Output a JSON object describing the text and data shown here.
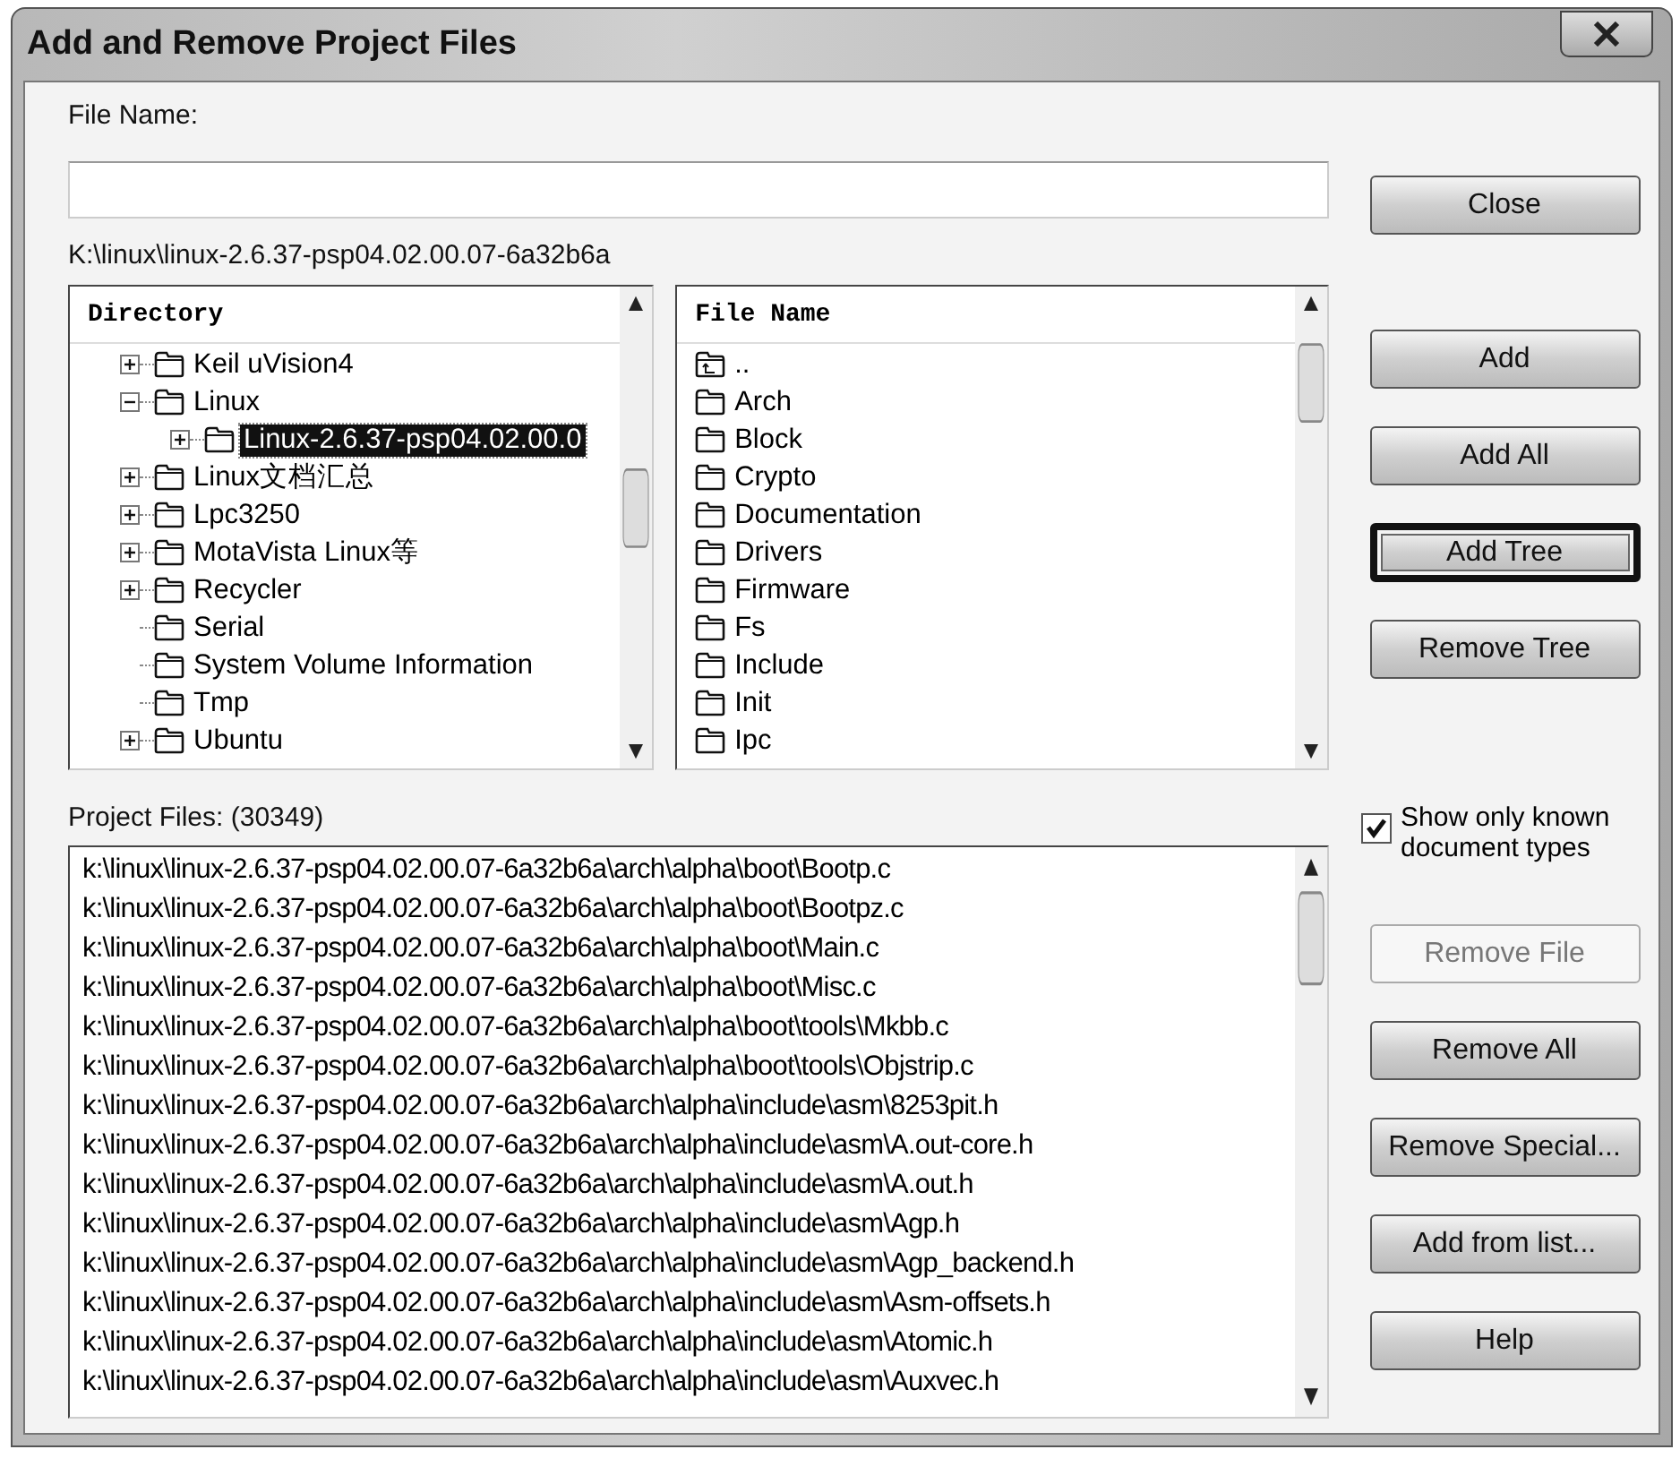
{
  "window": {
    "title": "Add and Remove Project Files"
  },
  "file_name": {
    "label": "File Name:"
  },
  "current_path": "K:\\linux\\linux-2.6.37-psp04.02.00.07-6a32b6a",
  "directory": {
    "header": "Directory",
    "items": [
      {
        "label": "Keil uVision4",
        "kind": "branch",
        "expanded": false,
        "selected": false
      },
      {
        "label": "Linux",
        "kind": "branch",
        "expanded": true,
        "selected": false,
        "children": [
          {
            "label": "Linux-2.6.37-psp04.02.00.0",
            "kind": "branch",
            "expanded": false,
            "selected": true
          }
        ]
      },
      {
        "label": "Linux文档汇总",
        "kind": "branch",
        "expanded": false,
        "selected": false
      },
      {
        "label": "Lpc3250",
        "kind": "branch",
        "expanded": false,
        "selected": false
      },
      {
        "label": "MotaVista Linux等",
        "kind": "branch",
        "expanded": false,
        "selected": false
      },
      {
        "label": "Recycler",
        "kind": "branch",
        "expanded": false,
        "selected": false
      },
      {
        "label": "Serial",
        "kind": "leaf",
        "selected": false
      },
      {
        "label": "System Volume Information",
        "kind": "leaf",
        "selected": false
      },
      {
        "label": "Tmp",
        "kind": "leaf",
        "selected": false
      },
      {
        "label": "Ubuntu",
        "kind": "branch",
        "expanded": false,
        "selected": false
      }
    ]
  },
  "files": {
    "header": "File Name",
    "items": [
      {
        "label": "..",
        "kind": "parent"
      },
      {
        "label": "Arch",
        "kind": "folder"
      },
      {
        "label": "Block",
        "kind": "folder"
      },
      {
        "label": "Crypto",
        "kind": "folder"
      },
      {
        "label": "Documentation",
        "kind": "folder"
      },
      {
        "label": "Drivers",
        "kind": "folder"
      },
      {
        "label": "Firmware",
        "kind": "folder"
      },
      {
        "label": "Fs",
        "kind": "folder"
      },
      {
        "label": "Include",
        "kind": "folder"
      },
      {
        "label": "Init",
        "kind": "folder"
      },
      {
        "label": "Ipc",
        "kind": "folder"
      }
    ]
  },
  "project_files": {
    "label": "Project Files: (30349)",
    "rows": [
      "k:\\linux\\linux-2.6.37-psp04.02.00.07-6a32b6a\\arch\\alpha\\boot\\Bootp.c",
      "k:\\linux\\linux-2.6.37-psp04.02.00.07-6a32b6a\\arch\\alpha\\boot\\Bootpz.c",
      "k:\\linux\\linux-2.6.37-psp04.02.00.07-6a32b6a\\arch\\alpha\\boot\\Main.c",
      "k:\\linux\\linux-2.6.37-psp04.02.00.07-6a32b6a\\arch\\alpha\\boot\\Misc.c",
      "k:\\linux\\linux-2.6.37-psp04.02.00.07-6a32b6a\\arch\\alpha\\boot\\tools\\Mkbb.c",
      "k:\\linux\\linux-2.6.37-psp04.02.00.07-6a32b6a\\arch\\alpha\\boot\\tools\\Objstrip.c",
      "k:\\linux\\linux-2.6.37-psp04.02.00.07-6a32b6a\\arch\\alpha\\include\\asm\\8253pit.h",
      "k:\\linux\\linux-2.6.37-psp04.02.00.07-6a32b6a\\arch\\alpha\\include\\asm\\A.out-core.h",
      "k:\\linux\\linux-2.6.37-psp04.02.00.07-6a32b6a\\arch\\alpha\\include\\asm\\A.out.h",
      "k:\\linux\\linux-2.6.37-psp04.02.00.07-6a32b6a\\arch\\alpha\\include\\asm\\Agp.h",
      "k:\\linux\\linux-2.6.37-psp04.02.00.07-6a32b6a\\arch\\alpha\\include\\asm\\Agp_backend.h",
      "k:\\linux\\linux-2.6.37-psp04.02.00.07-6a32b6a\\arch\\alpha\\include\\asm\\Asm-offsets.h",
      "k:\\linux\\linux-2.6.37-psp04.02.00.07-6a32b6a\\arch\\alpha\\include\\asm\\Atomic.h",
      "k:\\linux\\linux-2.6.37-psp04.02.00.07-6a32b6a\\arch\\alpha\\include\\asm\\Auxvec.h"
    ]
  },
  "buttons": [
    {
      "kind": "button",
      "label": "Close",
      "disabled": false,
      "focused": false
    },
    {
      "kind": "button",
      "label": "Add",
      "disabled": false,
      "focused": false
    },
    {
      "kind": "button",
      "label": "Add All",
      "disabled": false,
      "focused": false
    },
    {
      "kind": "button",
      "label": "Add Tree",
      "disabled": false,
      "focused": true
    },
    {
      "kind": "button",
      "label": "Remove Tree",
      "disabled": false,
      "focused": false
    },
    {
      "kind": "checkbox",
      "label": "Show only known document types",
      "checked": true
    },
    {
      "kind": "button",
      "label": "Remove File",
      "disabled": true,
      "focused": false
    },
    {
      "kind": "button",
      "label": "Remove All",
      "disabled": false,
      "focused": false
    },
    {
      "kind": "button",
      "label": "Remove Special...",
      "disabled": false,
      "focused": false
    },
    {
      "kind": "button",
      "label": "Add from list...",
      "disabled": false,
      "focused": false
    },
    {
      "kind": "button",
      "label": "Help",
      "disabled": false,
      "focused": false
    }
  ]
}
